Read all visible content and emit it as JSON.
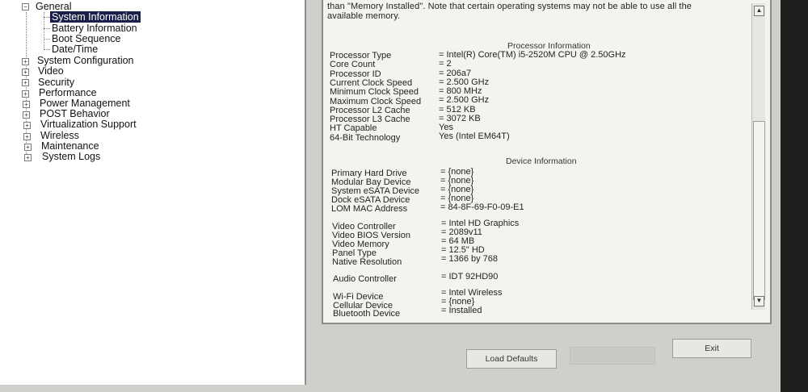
{
  "tree": {
    "items": [
      {
        "label": "General",
        "expanded": true
      },
      {
        "label": "System Information",
        "selected": true
      },
      {
        "label": "Battery Information"
      },
      {
        "label": "Boot Sequence"
      },
      {
        "label": "Date/Time"
      },
      {
        "label": "System Configuration"
      },
      {
        "label": "Video"
      },
      {
        "label": "Security"
      },
      {
        "label": "Performance"
      },
      {
        "label": "Power Management"
      },
      {
        "label": "POST Behavior"
      },
      {
        "label": "Virtualization Support"
      },
      {
        "label": "Wireless"
      },
      {
        "label": "Maintenance"
      },
      {
        "label": "System Logs"
      }
    ]
  },
  "info": {
    "intro_line1": "than \"Memory Installed\". Note that certain operating systems may not be able to use all the",
    "intro_line2": "available memory.",
    "processor": {
      "heading": "Processor Information",
      "rows": [
        {
          "label": "Processor Type",
          "value": "= Intel(R) Core(TM) i5-2520M CPU @ 2.50GHz"
        },
        {
          "label": "Core Count",
          "value": "= 2"
        },
        {
          "label": "Processor ID",
          "value": "= 206a7"
        },
        {
          "label": "Current Clock Speed",
          "value": "= 2.500 GHz"
        },
        {
          "label": "Minimum Clock Speed",
          "value": "= 800 MHz"
        },
        {
          "label": "Maximum Clock Speed",
          "value": "= 2.500 GHz"
        },
        {
          "label": "Processor L2 Cache",
          "value": "= 512 KB"
        },
        {
          "label": "Processor L3 Cache",
          "value": "= 3072 KB"
        },
        {
          "label": "HT Capable",
          "value": "Yes"
        },
        {
          "label": "64-Bit Technology",
          "value": "Yes (Intel EM64T)"
        }
      ]
    },
    "device": {
      "heading": "Device Information",
      "rows": [
        {
          "label": "Primary Hard Drive",
          "value": "= {none}"
        },
        {
          "label": "Modular Bay Device",
          "value": "= {none}"
        },
        {
          "label": "System eSATA Device",
          "value": "= {none}"
        },
        {
          "label": "Dock eSATA Device",
          "value": "= {none}"
        },
        {
          "label": "LOM MAC Address",
          "value": "= 84-8F-69-F0-09-E1"
        },
        {
          "label": "Video Controller",
          "value": "= Intel HD Graphics"
        },
        {
          "label": "Video BIOS Version",
          "value": "= 2089v11"
        },
        {
          "label": "Video Memory",
          "value": "= 64 MB"
        },
        {
          "label": "Panel Type",
          "value": "= 12.5\" HD"
        },
        {
          "label": "Native Resolution",
          "value": "= 1366 by 768"
        },
        {
          "label": "Audio Controller",
          "value": "= IDT 92HD90"
        },
        {
          "label": "Wi-Fi Device",
          "value": "= Intel Wireless"
        },
        {
          "label": "Cellular Device",
          "value": "= {none}"
        },
        {
          "label": "Bluetooth Device",
          "value": "= Installed"
        }
      ]
    }
  },
  "buttons": {
    "load_defaults": "Load Defaults",
    "exit": "Exit"
  },
  "colors": {
    "selection": "#1a1f4a",
    "panel": "#f4f4ef",
    "background": "#cfd0cb"
  }
}
